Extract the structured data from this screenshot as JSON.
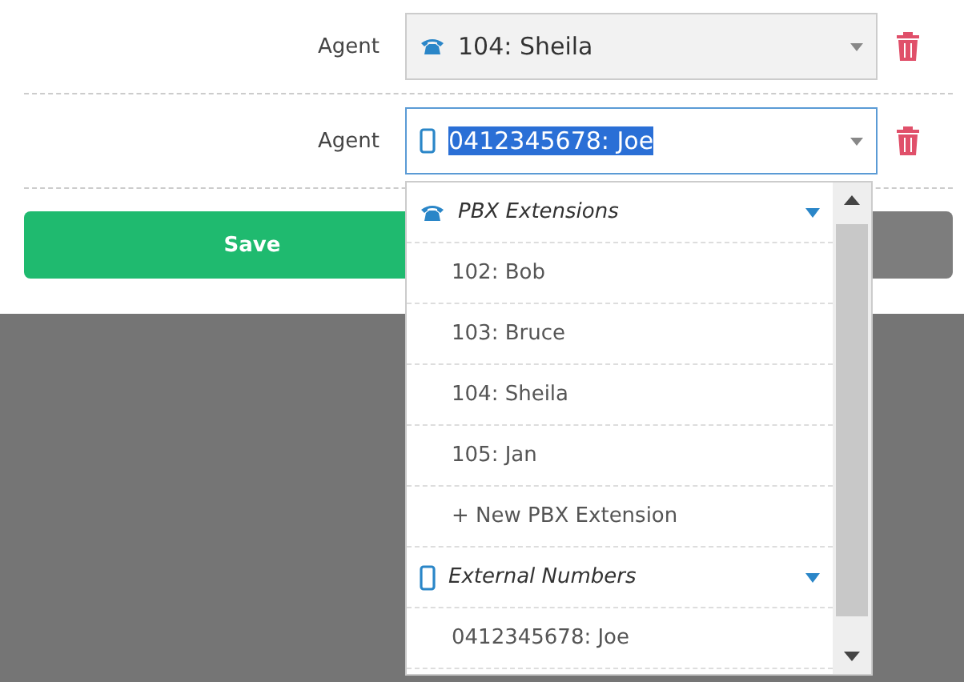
{
  "agents": [
    {
      "label": "Agent",
      "kind": "extension",
      "value": "104: Sheila",
      "focused": false,
      "text_selected": false
    },
    {
      "label": "Agent",
      "kind": "external",
      "value": "0412345678: Joe",
      "focused": true,
      "text_selected": true
    }
  ],
  "save_button": "Save",
  "dropdown": {
    "items": [
      {
        "kind": "extension_group",
        "label": "PBX Extensions",
        "expanded": true
      },
      {
        "kind": "option",
        "label": "102: Bob"
      },
      {
        "kind": "option",
        "label": "103: Bruce"
      },
      {
        "kind": "option",
        "label": "104: Sheila"
      },
      {
        "kind": "option",
        "label": "105: Jan"
      },
      {
        "kind": "action",
        "label": "+ New PBX Extension"
      },
      {
        "kind": "external_group",
        "label": "External Numbers",
        "expanded": true
      },
      {
        "kind": "option",
        "label": "0412345678: Joe"
      }
    ]
  }
}
